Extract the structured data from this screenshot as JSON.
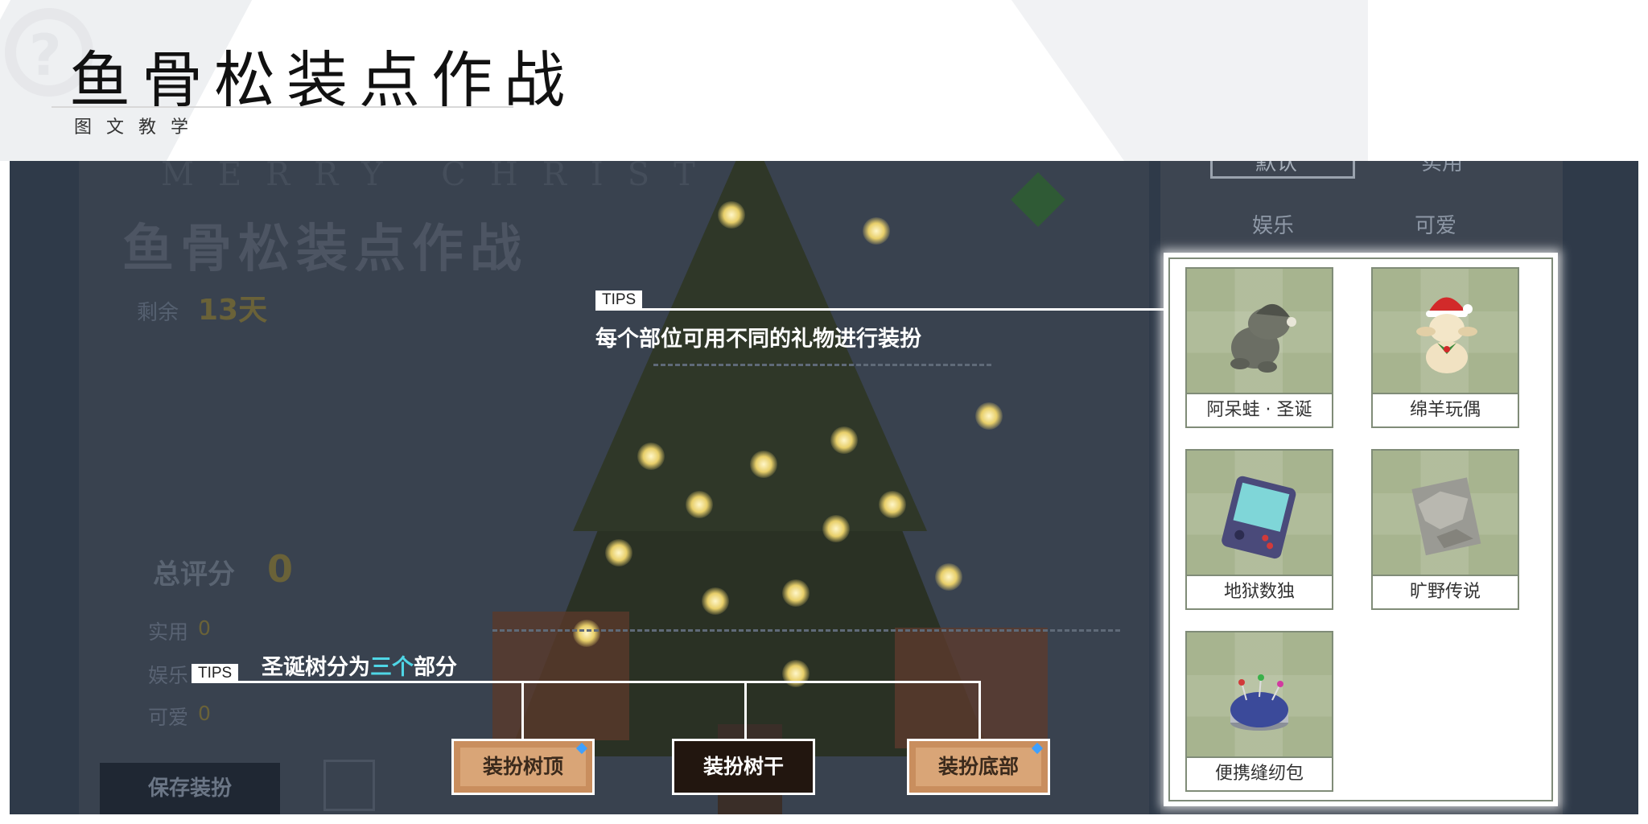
{
  "header": {
    "title": "鱼骨松装点作战",
    "subtitle": "图文教学"
  },
  "background_ui": {
    "merry_text": "MERRY CHRIST",
    "event_title": "鱼骨松装点作战",
    "remaining_label": "剩余",
    "remaining_days": "13天",
    "score_label": "总评分",
    "score_value": "0",
    "stats": [
      {
        "label": "实用",
        "value": "0"
      },
      {
        "label": "娱乐",
        "value": "0"
      },
      {
        "label": "可爱",
        "value": "0"
      }
    ],
    "save_button": "保存装扮",
    "filter_tabs": [
      "默认",
      "实用",
      "娱乐",
      "可爱"
    ]
  },
  "tips": [
    {
      "tag": "TIPS",
      "text": "每个部位可用不同的礼物进行装扮"
    },
    {
      "tag": "TIPS",
      "text_before": "圣诞树分为",
      "text_highlight": "三个",
      "text_after": "部分"
    }
  ],
  "parts": [
    {
      "label": "装扮树顶"
    },
    {
      "label": "装扮树干"
    },
    {
      "label": "装扮底部"
    }
  ],
  "gifts": [
    {
      "name": "阿呆蛙 · 圣诞",
      "icon": "frog-plush-icon"
    },
    {
      "name": "绵羊玩偶",
      "icon": "sheep-doll-icon"
    },
    {
      "name": "地狱数独",
      "icon": "handheld-console-icon"
    },
    {
      "name": "旷野传说",
      "icon": "map-tile-icon"
    },
    {
      "name": "便携缝纫包",
      "icon": "pincushion-icon"
    }
  ],
  "colors": {
    "highlight": "#4fd6e6",
    "stage_overlay": "#2f3a49",
    "gift_bg": "#a7b48f",
    "part_active": "#22160f",
    "part_inactive": "#c98e5e"
  }
}
